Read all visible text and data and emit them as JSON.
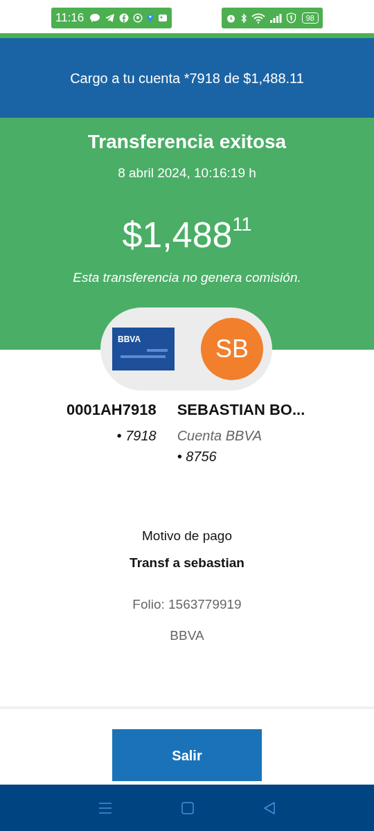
{
  "status_bar": {
    "time": "11:16",
    "battery": "98"
  },
  "header": {
    "title": "Cargo a tu cuenta *7918 de $1,488.11"
  },
  "result": {
    "title": "Transferencia exitosa",
    "datetime": "8 abril 2024, 10:16:19 h",
    "amount_whole": "$1,488",
    "amount_cents": "11",
    "note": "Esta transferencia no genera comisión."
  },
  "card": {
    "brand": "BBVA"
  },
  "recipient_avatar": {
    "initials": "SB"
  },
  "origin": {
    "account": "0001AH7918",
    "last_digits": "• 7918"
  },
  "destination": {
    "name": "SEBASTIAN BO...",
    "account_type": "Cuenta BBVA",
    "last_digits": "• 8756"
  },
  "details": {
    "label": "Motivo de pago",
    "reason": "Transf a sebastian",
    "folio": "Folio: 1563779919",
    "bank": "BBVA"
  },
  "exit_button": {
    "label": "Salir"
  }
}
